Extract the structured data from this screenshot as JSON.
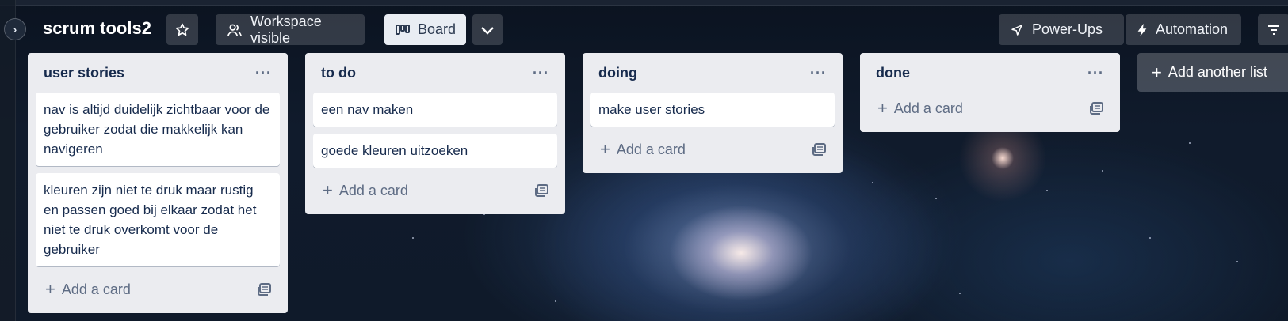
{
  "board": {
    "title": "scrum tools2",
    "visibility_label": "Workspace visible",
    "view_label": "Board",
    "powerups_label": "Power-Ups",
    "automation_label": "Automation",
    "add_list_label": "Add another list"
  },
  "icons": {
    "expand": "chevron-right-icon",
    "star": "star-icon",
    "visibility": "people-icon",
    "board_view": "board-icon",
    "view_switch": "chevron-down-icon",
    "powerups": "rocket-icon",
    "automation": "lightning-icon",
    "filter": "filter-icon",
    "list_menu": "ellipsis-icon",
    "template": "template-icon"
  },
  "lists": [
    {
      "title": "user stories",
      "cards": [
        "nav is altijd duidelijk zichtbaar voor de gebruiker zodat die makkelijk kan navigeren",
        "kleuren zijn niet te druk maar rustig en passen goed bij elkaar zodat het niet te druk overkomt voor de gebruiker"
      ],
      "add_label": "Add a card"
    },
    {
      "title": "to do",
      "cards": [
        "een nav maken",
        "goede kleuren uitzoeken"
      ],
      "add_label": "Add a card"
    },
    {
      "title": "doing",
      "cards": [
        "make user stories"
      ],
      "add_label": "Add a card"
    },
    {
      "title": "done",
      "cards": [],
      "add_label": "Add a card"
    }
  ],
  "colors": {
    "list_bg": "#ebecf0",
    "card_bg": "#ffffff",
    "text": "#172b4d"
  }
}
